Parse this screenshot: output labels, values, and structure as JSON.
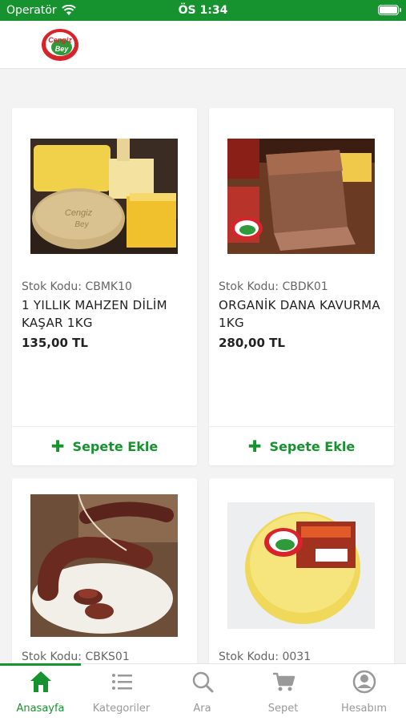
{
  "status_bar": {
    "carrier": "Operatör",
    "time": "ÖS 1:34"
  },
  "header": {
    "logo_text_top": "Cengiz",
    "logo_text_bottom": "Bey"
  },
  "products": [
    {
      "code": "Stok Kodu: CBMK10",
      "name": "1 YILLIK MAHZEN DİLİM KAŞAR 1KG",
      "price": "135,00 TL",
      "add_label": "Sepete Ekle",
      "image_icon": "kasar-cheese-image"
    },
    {
      "code": "Stok Kodu: CBDK01",
      "name": "ORGANİK DANA KAVURMA 1KG",
      "price": "280,00 TL",
      "add_label": "Sepete Ekle",
      "image_icon": "beef-kavurma-image"
    },
    {
      "code": "Stok Kodu: CBKS01",
      "name": "",
      "price": "",
      "add_label": "",
      "image_icon": "sucuk-sausage-image"
    },
    {
      "code": "Stok Kodu: 0031",
      "name": "",
      "price": "",
      "add_label": "",
      "image_icon": "gobek-cheese-image"
    }
  ],
  "tabs": [
    {
      "label": "Anasayfa",
      "icon": "home-icon",
      "active": true
    },
    {
      "label": "Kategoriler",
      "icon": "list-icon",
      "active": false
    },
    {
      "label": "Ara",
      "icon": "search-icon",
      "active": false
    },
    {
      "label": "Sepet",
      "icon": "cart-icon",
      "active": false
    },
    {
      "label": "Hesabım",
      "icon": "account-icon",
      "active": false
    }
  ],
  "colors": {
    "brand_green": "#16932f",
    "logo_red": "#d8232a",
    "background": "#f3f3f3"
  }
}
